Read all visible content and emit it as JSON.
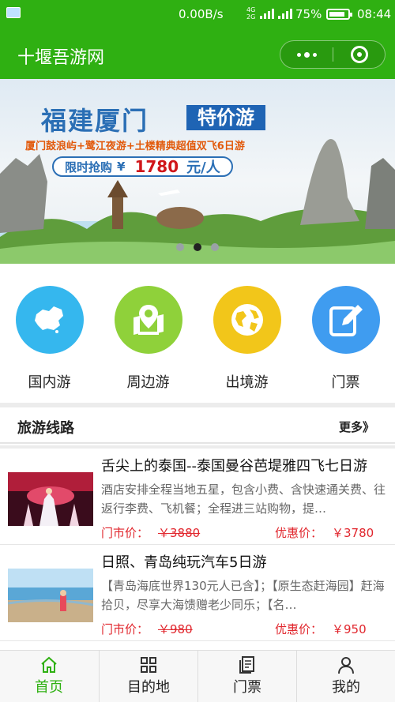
{
  "status_bar": {
    "net_speed": "0.00B/s",
    "signal_top": "4G",
    "signal_bottom": "2G",
    "battery": "75%",
    "time": "08:44"
  },
  "header": {
    "title": "十堰吾游网",
    "more_icon": "more-dots-icon",
    "close_icon": "target-circle-icon"
  },
  "banner": {
    "title": "福建厦门",
    "tag": "特价游",
    "subtitle": "厦门鼓浪屿+鹭江夜游+土楼精典超值双飞6日游",
    "promo_label": "限时抢购",
    "currency": "¥",
    "price": "1780",
    "unit": "元/人",
    "active_dot": 1
  },
  "categories": [
    {
      "label": "国内游",
      "icon": "china-map-icon",
      "color": "#35b7ee"
    },
    {
      "label": "周边游",
      "icon": "map-pin-icon",
      "color": "#8fd13a"
    },
    {
      "label": "出境游",
      "icon": "globe-icon",
      "color": "#f2c61a"
    },
    {
      "label": "门票",
      "icon": "edit-icon",
      "color": "#3f9cf0"
    }
  ],
  "section": {
    "title": "旅游线路",
    "more": "更多》"
  },
  "routes": [
    {
      "title": "舌尖上的泰国--泰国曼谷芭堤雅四飞七日游",
      "desc": "酒店安排全程当地五星，包含小费、含快速通关费、往返行李费、飞机餐；全程进三站购物，提…",
      "old_label": "门市价：",
      "old_price": "￥3880",
      "new_label": "优惠价：",
      "new_price": "￥3780"
    },
    {
      "title": "日照、青岛纯玩汽车5日游",
      "desc": "【青岛海底世界130元人已含】；【原生态赶海园】赶海拾贝，尽享大海馈赠老少同乐；【名…",
      "old_label": "门市价：",
      "old_price": "￥980",
      "new_label": "优惠价：",
      "new_price": "￥950"
    }
  ],
  "tabbar": [
    {
      "label": "首页",
      "icon": "home-icon",
      "active": true
    },
    {
      "label": "目的地",
      "icon": "grid-icon",
      "active": false
    },
    {
      "label": "门票",
      "icon": "ticket-icon",
      "active": false
    },
    {
      "label": "我的",
      "icon": "user-icon",
      "active": false
    }
  ],
  "colors": {
    "brand": "#2fb012",
    "price_red": "#e1262d"
  }
}
